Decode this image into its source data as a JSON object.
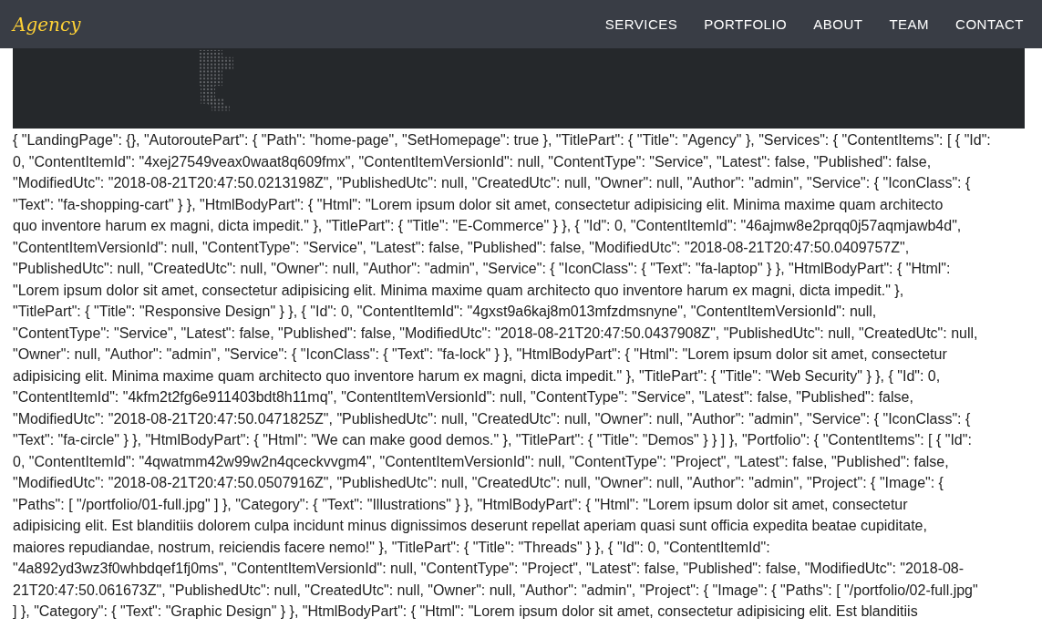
{
  "brand": "Agency",
  "nav": [
    {
      "label": "SERVICES"
    },
    {
      "label": "PORTFOLIO"
    },
    {
      "label": "ABOUT"
    },
    {
      "label": "TEAM"
    },
    {
      "label": "CONTACT"
    }
  ],
  "text_lines": [
    "{ \"LandingPage\": {}, \"AutoroutePart\": { \"Path\": \"home-page\", \"SetHomepage\": true }, \"TitlePart\": { \"Title\": \"Agency\" }, \"Services\": { \"ContentItems\": [ { \"Id\":",
    "0, \"ContentItemId\": \"4xej27549veax0waat8q609fmx\", \"ContentItemVersionId\": null, \"ContentType\": \"Service\", \"Latest\": false, \"Published\": false,",
    "\"ModifiedUtc\": \"2018-08-21T20:47:50.0213198Z\", \"PublishedUtc\": null, \"CreatedUtc\": null, \"Owner\": null, \"Author\": \"admin\", \"Service\": { \"IconClass\": {",
    "\"Text\": \"fa-shopping-cart\" } }, \"HtmlBodyPart\": { \"Html\": \"Lorem ipsum dolor sit amet, consectetur adipisicing elit. Minima maxime quam architecto",
    "quo inventore harum ex magni, dicta impedit.\" }, \"TitlePart\": { \"Title\": \"E-Commerce\" } }, { \"Id\": 0, \"ContentItemId\": \"46ajmw8e2prqq0j57aqmjawb4d\",",
    "\"ContentItemVersionId\": null, \"ContentType\": \"Service\", \"Latest\": false, \"Published\": false, \"ModifiedUtc\": \"2018-08-21T20:47:50.0409757Z\",",
    "\"PublishedUtc\": null, \"CreatedUtc\": null, \"Owner\": null, \"Author\": \"admin\", \"Service\": { \"IconClass\": { \"Text\": \"fa-laptop\" } }, \"HtmlBodyPart\": { \"Html\":",
    "\"Lorem ipsum dolor sit amet, consectetur adipisicing elit. Minima maxime quam architecto quo inventore harum ex magni, dicta impedit.\" },",
    "\"TitlePart\": { \"Title\": \"Responsive Design\" } }, { \"Id\": 0, \"ContentItemId\": \"4gxst9a6kaj8m013mfzdmsnyne\", \"ContentItemVersionId\": null,",
    "\"ContentType\": \"Service\", \"Latest\": false, \"Published\": false, \"ModifiedUtc\": \"2018-08-21T20:47:50.0437908Z\", \"PublishedUtc\": null, \"CreatedUtc\": null,",
    "\"Owner\": null, \"Author\": \"admin\", \"Service\": { \"IconClass\": { \"Text\": \"fa-lock\" } }, \"HtmlBodyPart\": { \"Html\": \"Lorem ipsum dolor sit amet, consectetur",
    "adipisicing elit. Minima maxime quam architecto quo inventore harum ex magni, dicta impedit.\" }, \"TitlePart\": { \"Title\": \"Web Security\" } }, { \"Id\": 0,",
    "\"ContentItemId\": \"4kfm2t2fg6e911403bdt8h11mq\", \"ContentItemVersionId\": null, \"ContentType\": \"Service\", \"Latest\": false, \"Published\": false,",
    "\"ModifiedUtc\": \"2018-08-21T20:47:50.0471825Z\", \"PublishedUtc\": null, \"CreatedUtc\": null, \"Owner\": null, \"Author\": \"admin\", \"Service\": { \"IconClass\": {",
    "\"Text\": \"fa-circle\" } }, \"HtmlBodyPart\": { \"Html\": \"We can make good demos.\" }, \"TitlePart\": { \"Title\": \"Demos\" } } ] }, \"Portfolio\": { \"ContentItems\": [ { \"Id\":",
    "0, \"ContentItemId\": \"4qwatmm42w99w2n4qceckvvgm4\", \"ContentItemVersionId\": null, \"ContentType\": \"Project\", \"Latest\": false, \"Published\": false,",
    "\"ModifiedUtc\": \"2018-08-21T20:47:50.0507916Z\", \"PublishedUtc\": null, \"CreatedUtc\": null, \"Owner\": null, \"Author\": \"admin\", \"Project\": { \"Image\": {",
    "\"Paths\": [ \"/portfolio/01-full.jpg\" ] }, \"Category\": { \"Text\": \"Illustrations\" } }, \"HtmlBodyPart\": { \"Html\": \"Lorem ipsum dolor sit amet, consectetur",
    "adipisicing elit. Est blanditiis dolorem culpa incidunt minus dignissimos deserunt repellat aperiam quasi sunt officia expedita beatae cupiditate,",
    "maiores repudiandae, nostrum, reiciendis facere nemo!\" }, \"TitlePart\": { \"Title\": \"Threads\" } }, { \"Id\": 0, \"ContentItemId\":",
    "\"4a892yd3wz3f0whbdqef1fj0ms\", \"ContentItemVersionId\": null, \"ContentType\": \"Project\", \"Latest\": false, \"Published\": false, \"ModifiedUtc\": \"2018-08-",
    "21T20:47:50.061673Z\", \"PublishedUtc\": null, \"CreatedUtc\": null, \"Owner\": null, \"Author\": \"admin\", \"Project\": { \"Image\": { \"Paths\": [ \"/portfolio/02-full.jpg\"",
    "] }, \"Category\": { \"Text\": \"Graphic Design\" } }, \"HtmlBodyPart\": { \"Html\": \"Lorem ipsum dolor sit amet, consectetur adipisicing elit. Est blanditiis"
  ]
}
